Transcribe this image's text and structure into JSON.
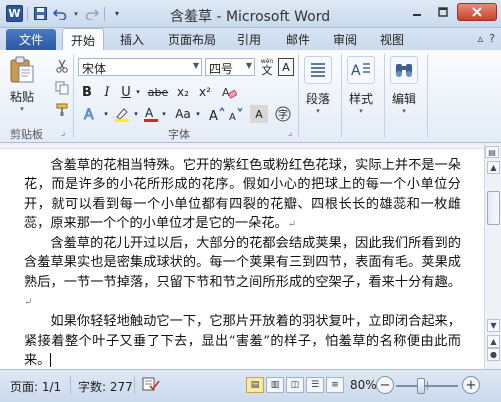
{
  "window": {
    "title": "含羞草 - Microsoft Word",
    "word_icon": "W",
    "qat": [
      "save-icon",
      "undo-icon",
      "redo-icon",
      "customize-qat-icon"
    ]
  },
  "tabs": {
    "file": "文件",
    "items": [
      "开始",
      "插入",
      "页面布局",
      "引用",
      "邮件",
      "审阅",
      "视图"
    ],
    "active": "开始"
  },
  "ribbon": {
    "clipboard": {
      "paste_label": "粘贴",
      "group_label": "剪贴板"
    },
    "font": {
      "font_name": "宋体",
      "font_size": "四号",
      "group_label": "字体",
      "buttons": [
        "B",
        "I",
        "U",
        "abe",
        "x₂",
        "x²",
        "Aa"
      ],
      "wen_label": "wén",
      "border_char": "A"
    },
    "paragraph": {
      "label": "段落"
    },
    "styles": {
      "label": "样式"
    },
    "editing": {
      "label": "编辑"
    }
  },
  "document": {
    "paragraphs": [
      "含羞草的花相当特殊。它开的紫红色或粉红色花球，实际上并不是一朵花，而是许多的小花所形成的花序。假如小心的把球上的每一个小单位分开，就可以看到每一个小单位都有四裂的花瓣、四根长长的雄蕊和一枚雌蕊，原来那一个个的小单位才是它的一朵花。",
      "含羞草的花儿开过以后，大部分的花都会结成荚果，因此我们所看到的含羞草果实也是密集成球状的。每一个荚果有三到四节，表面有毛。荚果成熟后，一节一节掉落，只留下节和节之间所形成的空架子，看来十分有趣。",
      "如果你轻轻地触动它一下，它那片开放着的羽状复叶，立即闭合起来，紧接着整个叶子又垂了下去，显出“害羞”的样子，怕羞草的名称便由此而来。"
    ],
    "para_mark": "↵"
  },
  "status": {
    "page": "页面: 1/1",
    "words": "字数: 277",
    "zoom": "80%",
    "zoom_fraction": 0.4
  },
  "colors": {
    "accent": "#2b579a",
    "file_tab": "#2a5aa6"
  }
}
